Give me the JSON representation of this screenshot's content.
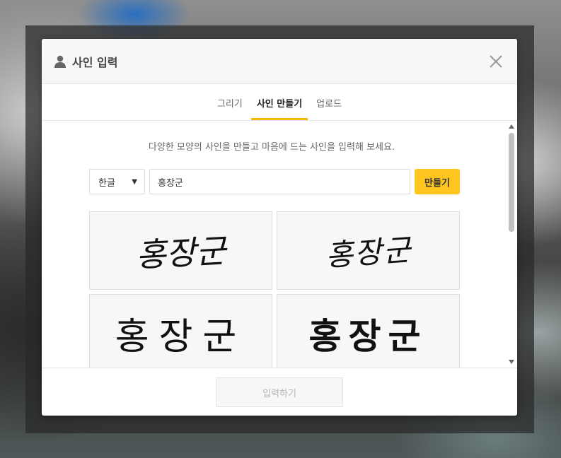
{
  "dialog": {
    "title": "사인 입력",
    "icon": "person-icon",
    "close_icon": "close-icon"
  },
  "tabs": [
    {
      "label": "그리기",
      "active": false
    },
    {
      "label": "사인 만들기",
      "active": true
    },
    {
      "label": "업로드",
      "active": false
    }
  ],
  "make_sign": {
    "instruction": "다양한 모양의 사인을 만들고 마음에 드는 사인을 입력해 보세요.",
    "language_select": {
      "selected": "한글"
    },
    "name_input": {
      "value": "홍장군"
    },
    "make_button_label": "만들기",
    "signatures": [
      "홍장군",
      "홍장군",
      "홍장군",
      "홍장군"
    ]
  },
  "footer": {
    "submit_label": "입력하기",
    "submit_enabled": false
  },
  "colors": {
    "accent": "#fdc51e",
    "tab_underline": "#f5b800",
    "card_bg": "#f7f7f7"
  }
}
